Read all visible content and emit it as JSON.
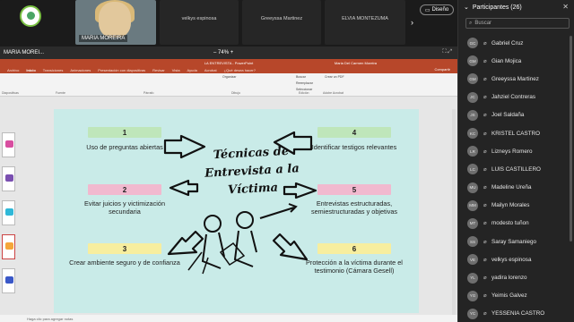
{
  "tiles": {
    "self_name": "",
    "maria": "MARIA MOREIRA",
    "t1": "velkys espinosa",
    "t2": "Greeyssa Martinez",
    "t3": "ELVIA MONTEZUMA",
    "design_button": "Diseño"
  },
  "presenter": {
    "name": "MARIA MOREI...",
    "zoom": "74%"
  },
  "powerpoint": {
    "doc_title": "LA ENTREVISTA - PowerPoint",
    "user": "Maria Del Carmen Moreira",
    "share": "Compartir",
    "search": "¿Qué desea hacer?",
    "menu": [
      "Archivo",
      "Inicio",
      "Transiciones",
      "Animaciones",
      "Presentación con diapositivas",
      "Revisar",
      "Vista",
      "Ayuda",
      "Acrobat"
    ],
    "ribbon": {
      "clipboard": "Portapapeles",
      "font": "Fuente",
      "paragraph": "Párrafo",
      "drawing": "Dibujo",
      "editing": "Edición",
      "create_pdf": "Crear un PDF",
      "slides": "Diapositivas",
      "acrobat": "Adobe Acrobat",
      "organize": "Organizar",
      "find": "Buscar",
      "replace": "Reemplazar",
      "select": "Seleccionar"
    },
    "notes": "Haga clic para agregar notas"
  },
  "slide": {
    "title": "Técnicas de Entrevista a la Víctima",
    "items": [
      {
        "num": "1",
        "text": "Uso de preguntas abiertas",
        "color": "#bfe6ba"
      },
      {
        "num": "2",
        "text": "Evitar juicios y victimización secundaria",
        "color": "#f1b9cf"
      },
      {
        "num": "3",
        "text": "Crear ambiente seguro y de confianza",
        "color": "#f7ee9f"
      },
      {
        "num": "4",
        "text": "Identificar testigos relevantes",
        "color": "#bfe6ba"
      },
      {
        "num": "5",
        "text": "Entrevistas estructuradas, semiestructuradas y objetivas",
        "color": "#f1b9cf"
      },
      {
        "num": "6",
        "text": "Protección a la víctima durante el testimonio (Cámara Gesell)",
        "color": "#f7ee9f"
      }
    ]
  },
  "panel": {
    "title": "Participantes (26)",
    "search_placeholder": "Buscar",
    "participants": [
      {
        "initials": "GC",
        "name": "Gabriel Cruz"
      },
      {
        "initials": "GM",
        "name": "Gian Mojica"
      },
      {
        "initials": "GM",
        "name": "Greeyssa Martinez"
      },
      {
        "initials": "JC",
        "name": "Jahziel Contreras"
      },
      {
        "initials": "JS",
        "name": "Joel Saldaña"
      },
      {
        "initials": "KC",
        "name": "KRISTEL CASTRO"
      },
      {
        "initials": "LR",
        "name": "Lizneys Romero"
      },
      {
        "initials": "LC",
        "name": "LUIS CASTILLERO"
      },
      {
        "initials": "MU",
        "name": "Madeline Ureña"
      },
      {
        "initials": "MM",
        "name": "Mailyn Morales"
      },
      {
        "initials": "MT",
        "name": "modesto tuñon"
      },
      {
        "initials": "SS",
        "name": "Saray Samaniego"
      },
      {
        "initials": "VE",
        "name": "velkys espinosa"
      },
      {
        "initials": "YL",
        "name": "yadira lorenzo"
      },
      {
        "initials": "YG",
        "name": "Yeimis Galvez"
      },
      {
        "initials": "YC",
        "name": "YESSENIA CASTRO"
      }
    ]
  }
}
